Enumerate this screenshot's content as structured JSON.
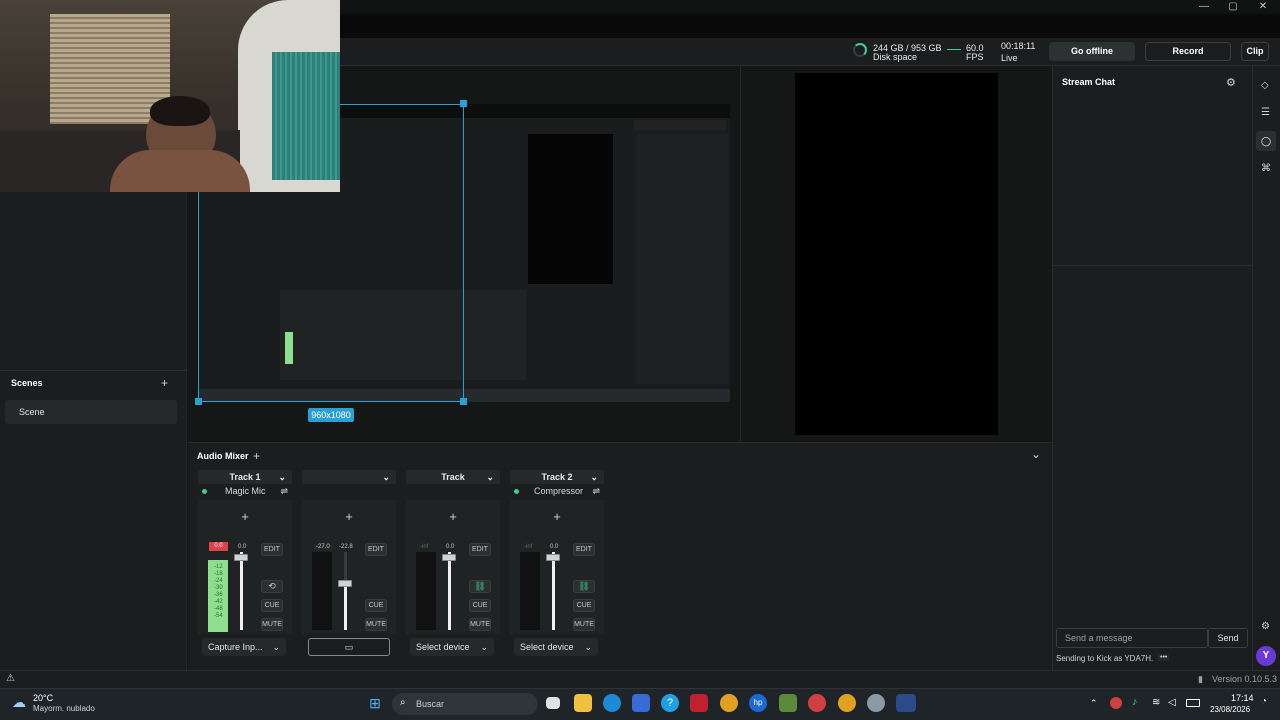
{
  "window_controls": {
    "minimize": "—",
    "maximize": "▢",
    "close": "✕"
  },
  "header": {
    "disk_value": "244 GB / 953 GB",
    "disk_label": "Disk space",
    "fps_value": "60.0",
    "fps_label": "FPS",
    "time_value": "00:18:11",
    "time_label": "Live",
    "go_offline": "Go offline",
    "record": "Record",
    "clip": "Clip"
  },
  "scenes": {
    "title": "Scenes",
    "add": "+",
    "items": [
      "Scene"
    ]
  },
  "preview": {
    "size_badge": "960x1080"
  },
  "mixer": {
    "title": "Audio Mixer",
    "add": "+",
    "collapse": "⌄",
    "tracks": [
      {
        "name": "Track 1",
        "source": "Magic Mic",
        "peak": "0.0",
        "gain": "0.0",
        "device": "Capture Inp...",
        "scale": [
          "-12",
          "-18",
          "-24",
          "-30",
          "-36",
          "-42",
          "-48",
          "-54"
        ]
      },
      {
        "name": "",
        "source": "",
        "peak": "-27.0",
        "gain": "-22.8",
        "device": ""
      },
      {
        "name": "Track",
        "source": "",
        "peak": "-inf",
        "gain": "0.0",
        "device": "Select device"
      },
      {
        "name": "Track 2",
        "source": "Compressor",
        "peak": "-inf",
        "gain": "0.0",
        "device": "Select device"
      }
    ],
    "edit": "EDIT",
    "cue": "CUE",
    "mute": "MUTE"
  },
  "chat": {
    "title": "Stream Chat",
    "placeholder": "Send a message",
    "send": "Send",
    "sending_as": "Sending to Kick as YDA7H.",
    "more": "•••",
    "avatar_letter": "Y"
  },
  "status": {
    "version": "Version 0.10.5.3"
  },
  "taskbar": {
    "temperature": "20°C",
    "weather": "Mayorm. nublado",
    "search_placeholder": "Buscar",
    "time": "17:14",
    "date": "23/08/2026"
  },
  "colors": {
    "accent": "#2a9fd6",
    "live_green": "#3ccf8e",
    "meter_green": "#8ee08e",
    "meter_red": "#e0404a"
  }
}
